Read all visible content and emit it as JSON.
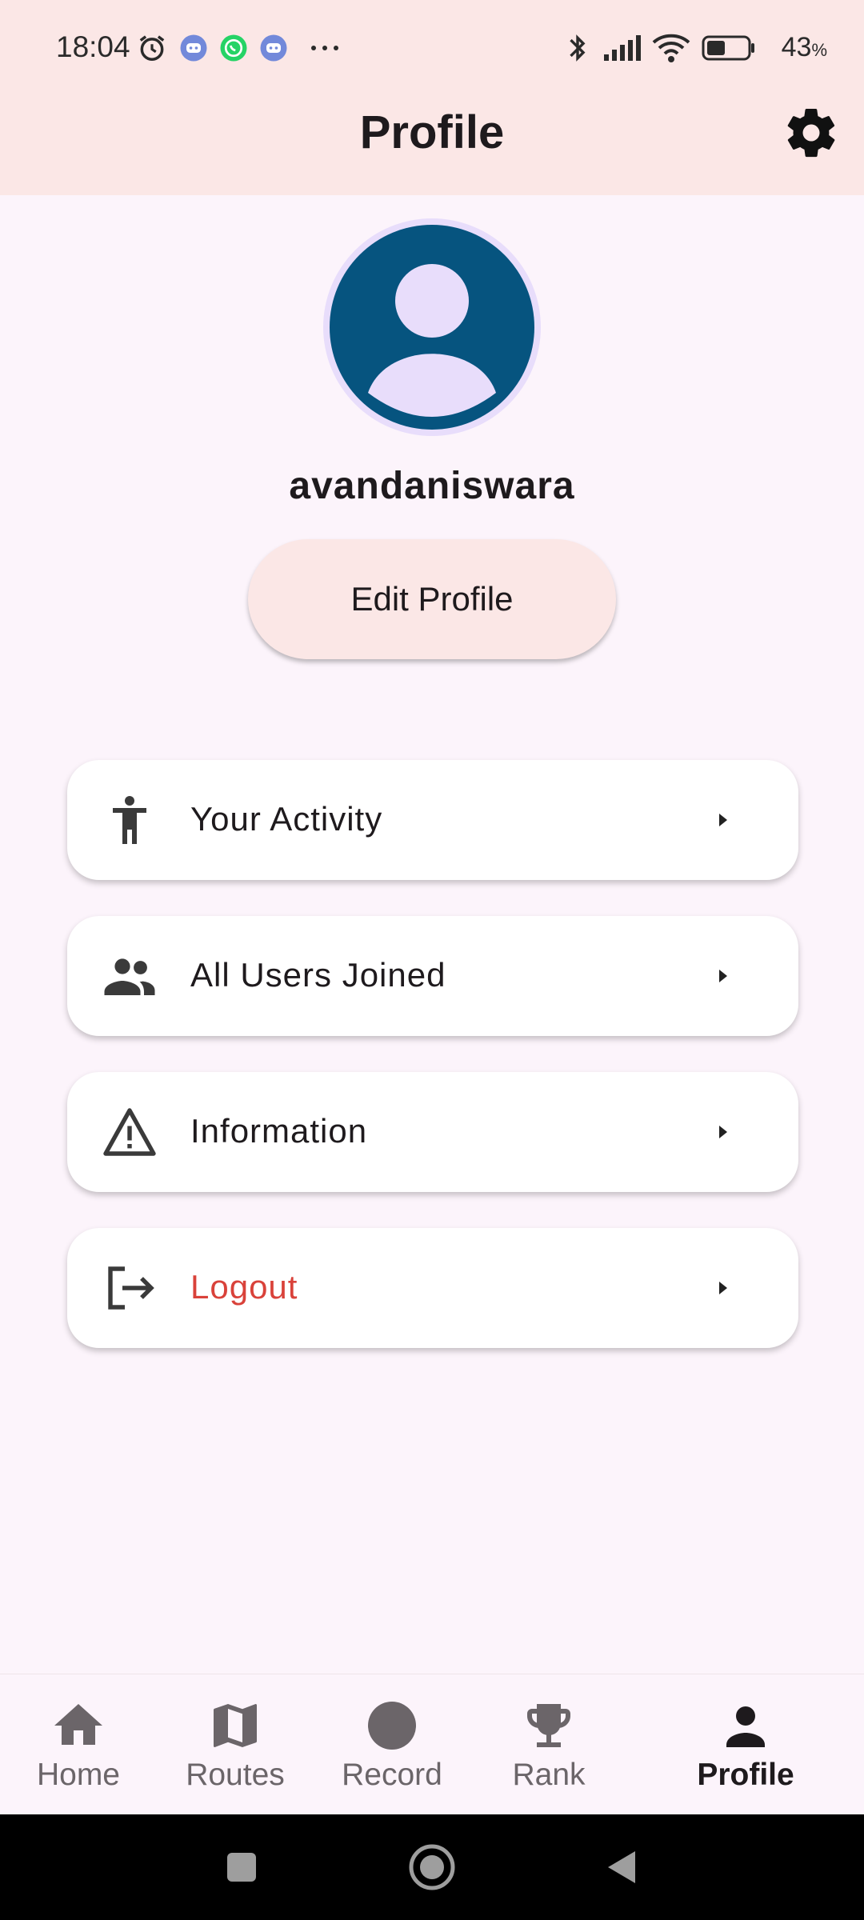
{
  "status_bar": {
    "time": "18:04",
    "battery_percent": "43",
    "battery_suffix": "%",
    "icons": [
      "alarm-icon",
      "discord-icon",
      "whatsapp-icon",
      "discord-icon",
      "more-icon",
      "bluetooth-icon",
      "signal-icon",
      "wifi-icon",
      "battery-icon"
    ]
  },
  "app_bar": {
    "title": "Profile",
    "settings_icon": "gear-icon"
  },
  "profile": {
    "username": "avandaniswara",
    "edit_button": "Edit Profile"
  },
  "menu": [
    {
      "label": "Your Activity",
      "icon": "accessibility-icon"
    },
    {
      "label": "All Users Joined",
      "icon": "people-icon"
    },
    {
      "label": "Information",
      "icon": "warning-icon"
    },
    {
      "label": "Logout",
      "icon": "logout-icon"
    }
  ],
  "bottom_nav": {
    "items": [
      {
        "label": "Home",
        "icon": "home-icon"
      },
      {
        "label": "Routes",
        "icon": "map-icon"
      },
      {
        "label": "Record",
        "icon": "record-icon"
      },
      {
        "label": "Rank",
        "icon": "trophy-icon"
      },
      {
        "label": "Profile",
        "icon": "person-icon"
      }
    ],
    "active": "Profile"
  },
  "colors": {
    "header_bg": "#fbe7e6",
    "page_bg": "#fcf4fb",
    "avatar_bg": "#06547f",
    "avatar_fg": "#e8ddfb",
    "logout": "#d9423a"
  }
}
